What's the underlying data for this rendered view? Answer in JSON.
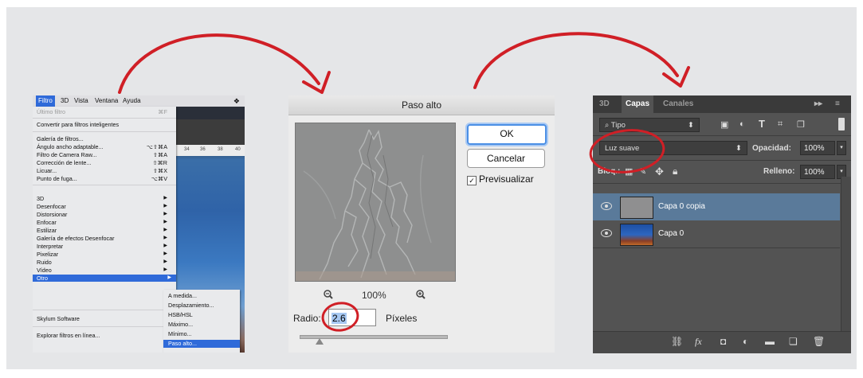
{
  "menubar": {
    "items": [
      "Filtro",
      "3D",
      "Vista",
      "Ventana",
      "Ayuda"
    ],
    "dropbox_icon": "dropbox-icon"
  },
  "filter_menu": {
    "last_filter": "Último filtro",
    "last_filter_shortcut": "⌘F",
    "convert": "Convertir para filtros inteligentes",
    "group1": [
      {
        "label": "Galería de filtros...",
        "shortcut": ""
      },
      {
        "label": "Ángulo ancho adaptable...",
        "shortcut": "⌥⇧⌘A"
      },
      {
        "label": "Filtro de Camera Raw...",
        "shortcut": "⇧⌘A"
      },
      {
        "label": "Corrección de lente...",
        "shortcut": "⇧⌘R"
      },
      {
        "label": "Licuar...",
        "shortcut": "⇧⌘X"
      },
      {
        "label": "Punto de fuga...",
        "shortcut": "⌥⌘V"
      }
    ],
    "group2": [
      "3D",
      "Desenfocar",
      "Distorsionar",
      "Enfocar",
      "Estilizar",
      "Galería de efectos Desenfocar",
      "Interpretar",
      "Pixelizar",
      "Ruido",
      "Vídeo",
      "Otro"
    ],
    "skylum": "Skylum Software",
    "explore": "Explorar filtros en línea...",
    "ruler_ticks": [
      "34",
      "36",
      "38",
      "40"
    ]
  },
  "submenu": {
    "items": [
      "A medida...",
      "Desplazamiento...",
      "HSB/HSL",
      "Máximo...",
      "Mínimo...",
      "Paso alto..."
    ],
    "selected": "Paso alto..."
  },
  "high_pass": {
    "title": "Paso alto",
    "ok_label": "OK",
    "cancel_label": "Cancelar",
    "preview_label": "Previsualizar",
    "preview_checked": true,
    "check_mark": "✓",
    "zoom_level": "100%",
    "radius_label": "Radio:",
    "radius_value": "2.6",
    "unit_label": "Píxeles"
  },
  "layers_panel": {
    "tabs": [
      "3D",
      "Capas",
      "Canales"
    ],
    "active_tab": "Capas",
    "filter_kind": "Tipo",
    "blend_mode": "Luz suave",
    "opacity_label": "Opacidad:",
    "opacity_value": "100%",
    "lock_label": "Bloq.:",
    "fill_label": "Relleno:",
    "fill_value": "100%",
    "layers": [
      {
        "name": "Capa 0 copia",
        "selected": true
      },
      {
        "name": "Capa 0",
        "selected": false
      }
    ]
  },
  "colors": {
    "accent_red": "#d01f26",
    "menu_highlight": "#2f6ad9",
    "panel_dark": "#535353",
    "selected_layer": "#5a7a9a"
  }
}
